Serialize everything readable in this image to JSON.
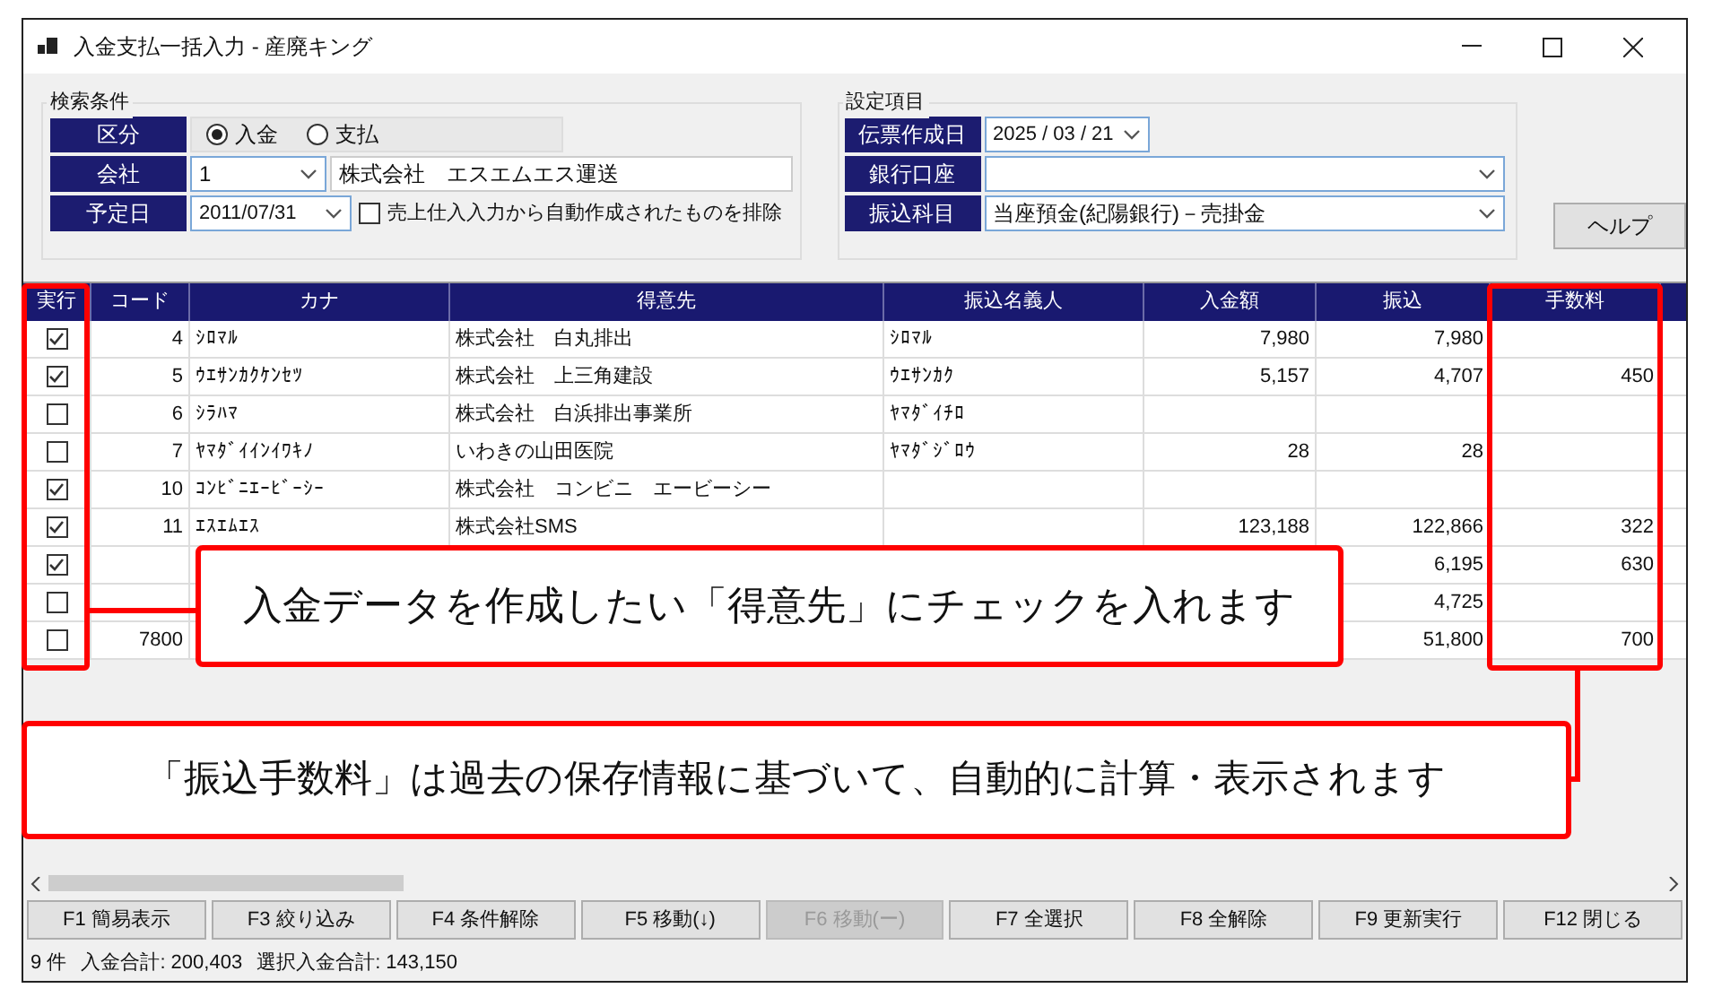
{
  "window": {
    "title": "入金支払一括入力 - 産廃キング"
  },
  "search": {
    "title": "検索条件",
    "fields": [
      {
        "kind": "radio",
        "label": "区分",
        "options": [
          {
            "label": "入金",
            "selected": true
          },
          {
            "label": "支払",
            "selected": false
          }
        ]
      },
      {
        "kind": "company",
        "label": "会社",
        "code": "1",
        "name": "株式会社　エスエムエス運送"
      },
      {
        "kind": "date",
        "label": "予定日",
        "value": "2011/07/31",
        "checkbox": {
          "label": "売上仕入入力から自動作成されたものを排除",
          "checked": false
        }
      }
    ]
  },
  "settings": {
    "title": "設定項目",
    "fields": [
      {
        "kind": "date",
        "label": "伝票作成日",
        "value": "2025 / 03 / 21"
      },
      {
        "kind": "select",
        "label": "銀行口座"
      },
      {
        "kind": "select",
        "label": "振込科目",
        "value": "当座預金(紀陽銀行)－売掛金"
      }
    ]
  },
  "help_button": "ヘルプ",
  "table": {
    "columns": [
      "実行",
      "コード",
      "カナ",
      "得意先",
      "振込名義人",
      "入金額",
      "振込",
      "手数料"
    ],
    "rows": [
      {
        "checked": true,
        "code": "4",
        "kana": "ｼﾛﾏﾙ",
        "customer": "株式会社　白丸排出",
        "payer": "ｼﾛﾏﾙ",
        "amount": "7,980",
        "transfer": "7,980"
      },
      {
        "checked": true,
        "code": "5",
        "kana": "ｳｴｻﾝｶｸｹﾝｾﾂ",
        "customer": "株式会社　上三角建設",
        "payer": "ｳｴｻﾝｶｸ",
        "amount": "5,157",
        "transfer": "4,707",
        "fee": "450"
      },
      {
        "checked": false,
        "code": "6",
        "kana": "ｼﾗﾊﾏ",
        "customer": "株式会社　白浜排出事業所",
        "payer": "ﾔﾏﾀﾞｲﾁﾛ"
      },
      {
        "checked": false,
        "code": "7",
        "kana": "ﾔﾏﾀﾞｲｲﾝｲﾜｷﾉ",
        "customer": "いわきの山田医院",
        "payer": "ﾔﾏﾀﾞｼﾞﾛｳ",
        "amount": "28",
        "transfer": "28"
      },
      {
        "checked": true,
        "code": "10",
        "kana": "ｺﾝﾋﾞﾆｴｰﾋﾞｰｼｰ",
        "customer": "株式会社　コンビニ　エービーシー"
      },
      {
        "checked": true,
        "code": "11",
        "kana": "ｴｽｴﾑｴｽ",
        "customer": "株式会社SMS",
        "amount": "123,188",
        "transfer": "122,866",
        "fee": "322"
      },
      {
        "checked": true,
        "transfer": "6,195",
        "fee": "630"
      },
      {
        "checked": false,
        "transfer": "4,725"
      },
      {
        "checked": false,
        "code": "7800",
        "transfer": "51,800",
        "fee": "700"
      }
    ]
  },
  "callouts": [
    "入金データを作成したい「得意先」にチェックを入れます",
    "「振込手数料」は過去の保存情報に基づいて、自動的に計算・表示されます"
  ],
  "fkeys": [
    {
      "label": "F1 簡易表示",
      "disabled": false
    },
    {
      "label": "F3 絞り込み",
      "disabled": false
    },
    {
      "label": "F4 条件解除",
      "disabled": false
    },
    {
      "label": "F5 移動(↓)",
      "disabled": false
    },
    {
      "label": "F6 移動(ー)",
      "disabled": true
    },
    {
      "label": "F7 全選択",
      "disabled": false
    },
    {
      "label": "F8 全解除",
      "disabled": false
    },
    {
      "label": "F9 更新実行",
      "disabled": false
    },
    {
      "label": "F12 閉じる",
      "disabled": false
    }
  ],
  "status_bar": [
    "9 件",
    "入金合計: 200,403",
    "選択入金合計: 143,150"
  ]
}
